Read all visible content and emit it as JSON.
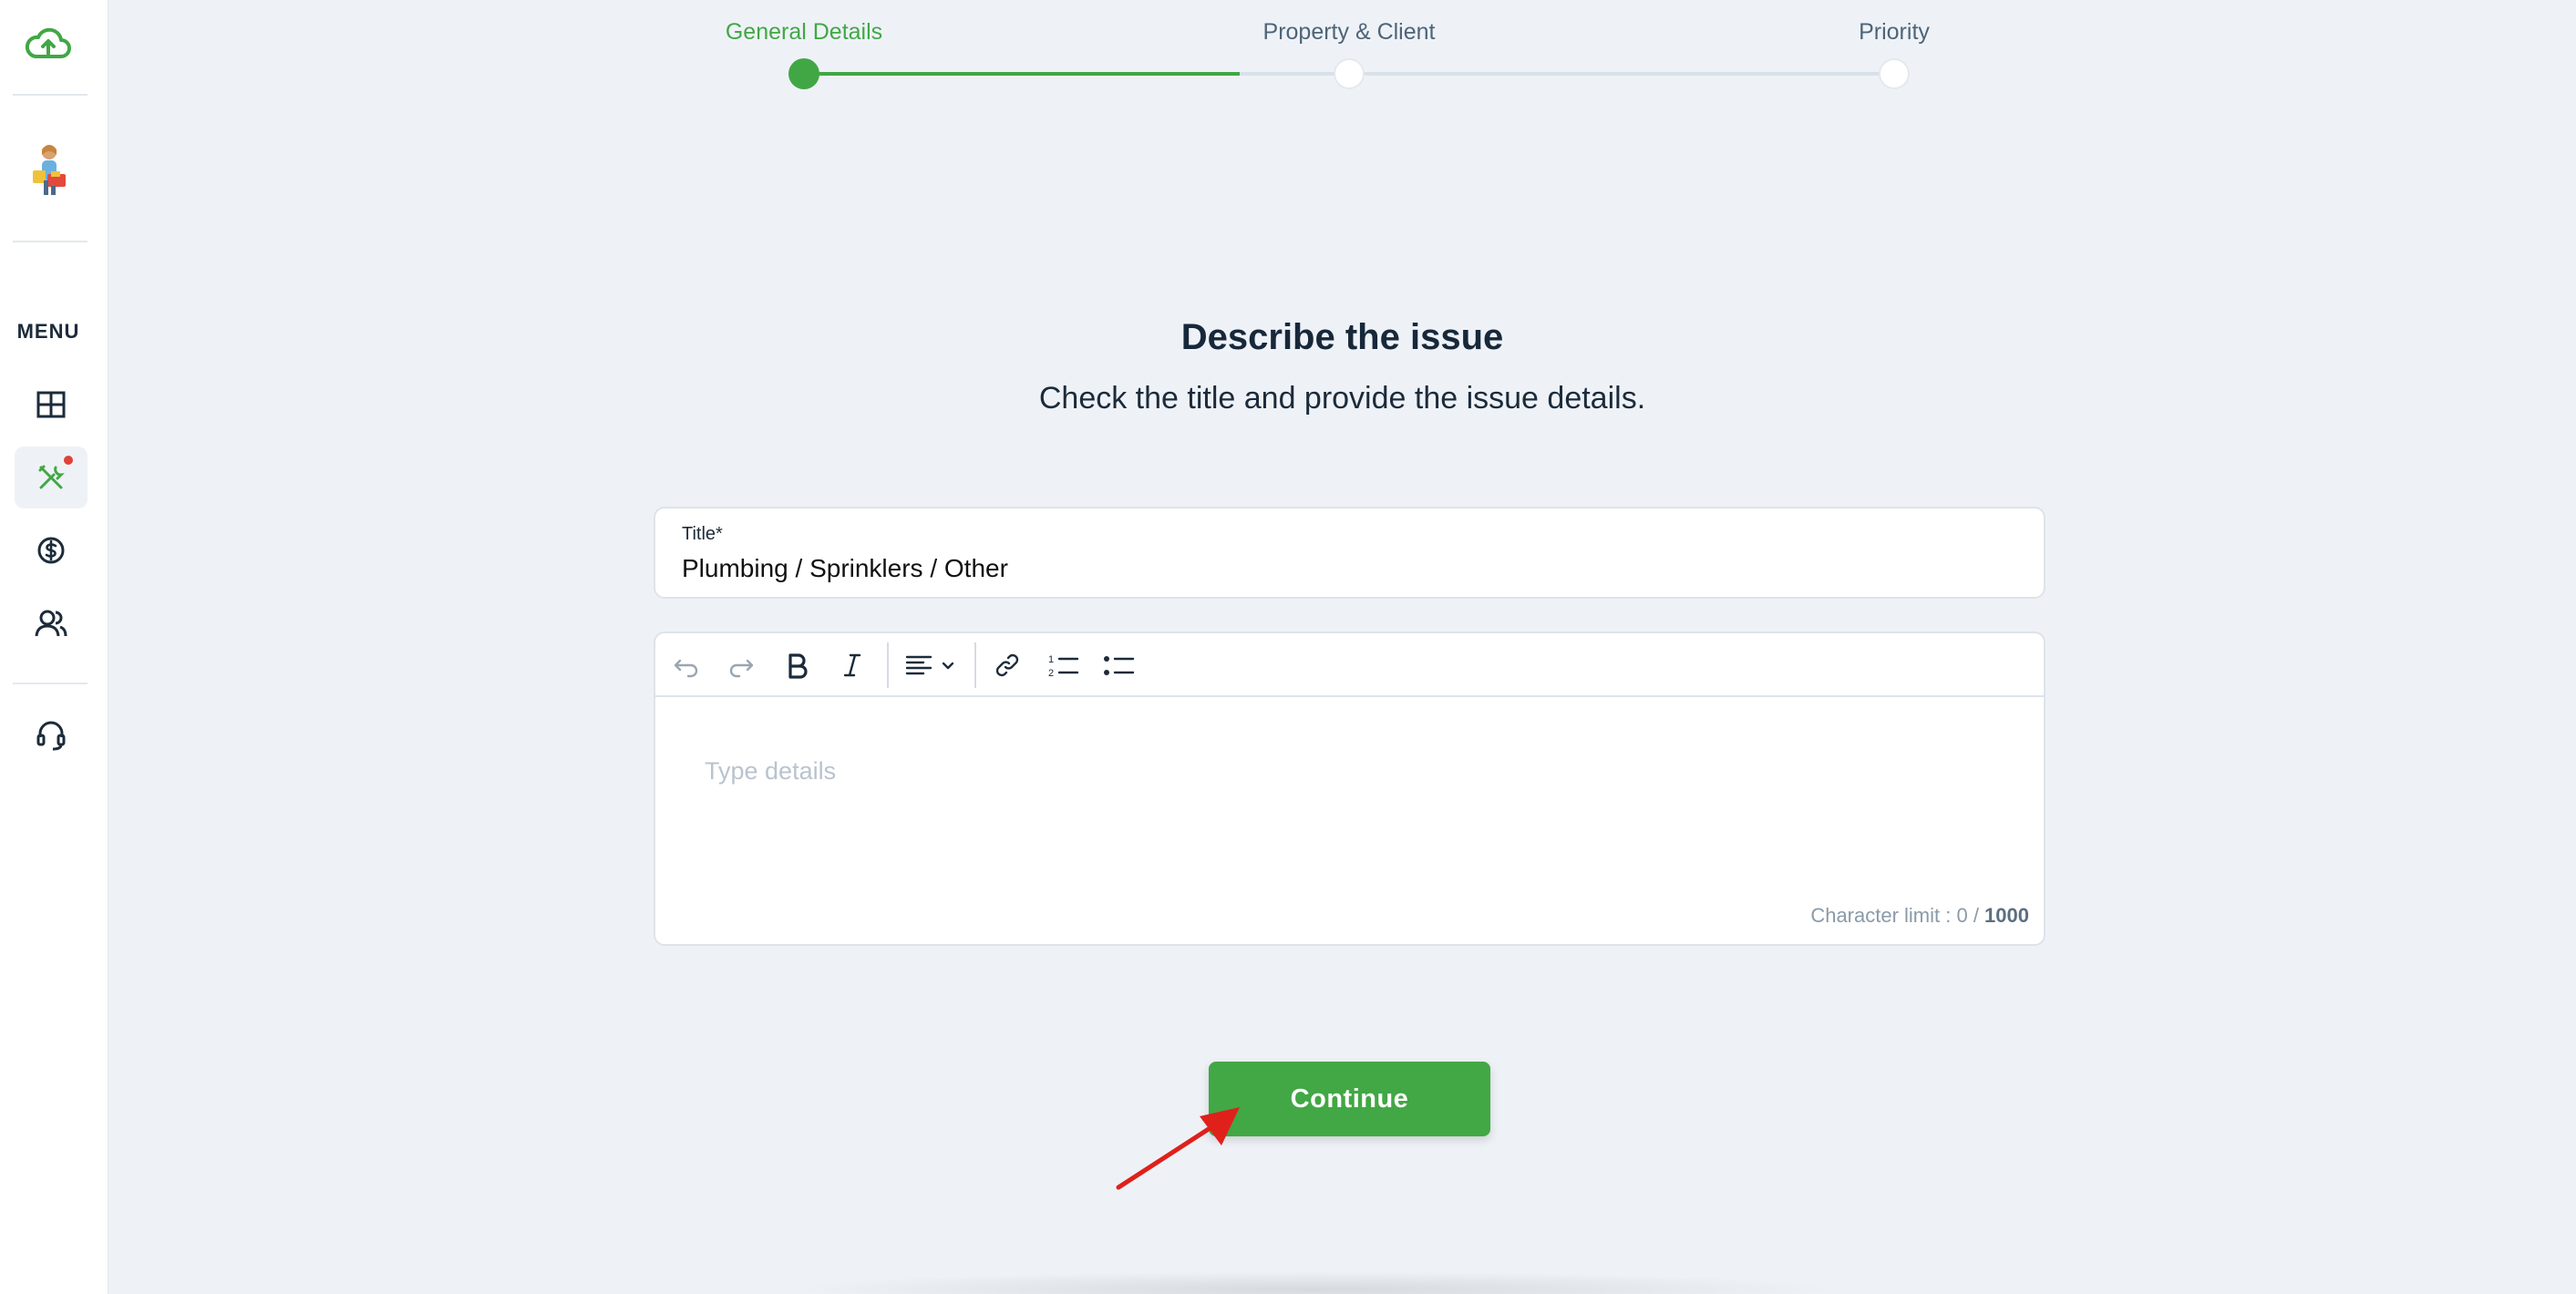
{
  "sidebar": {
    "menu_label": "MENU",
    "items": [
      {
        "name": "dashboard",
        "icon": "dashboard-icon"
      },
      {
        "name": "maintenance",
        "icon": "tools-icon",
        "active": true,
        "notification": true
      },
      {
        "name": "payments",
        "icon": "dollar-icon"
      },
      {
        "name": "contacts",
        "icon": "users-icon"
      },
      {
        "name": "support",
        "icon": "headset-icon"
      }
    ]
  },
  "stepper": {
    "steps": [
      {
        "label": "General Details",
        "state": "active"
      },
      {
        "label": "Property & Client",
        "state": "pending"
      },
      {
        "label": "Priority",
        "state": "pending"
      }
    ]
  },
  "form": {
    "heading": "Describe the issue",
    "subheading": "Check the title and provide the issue details.",
    "title_label": "Title*",
    "title_value": "Plumbing / Sprinklers / Other",
    "details_placeholder": "Type details",
    "char_limit_prefix": "Character limit : 0 / ",
    "char_limit_max": "1000",
    "continue_label": "Continue"
  },
  "colors": {
    "accent": "#42a745",
    "background": "#eef2f7",
    "annotation_arrow": "#e0201b"
  }
}
